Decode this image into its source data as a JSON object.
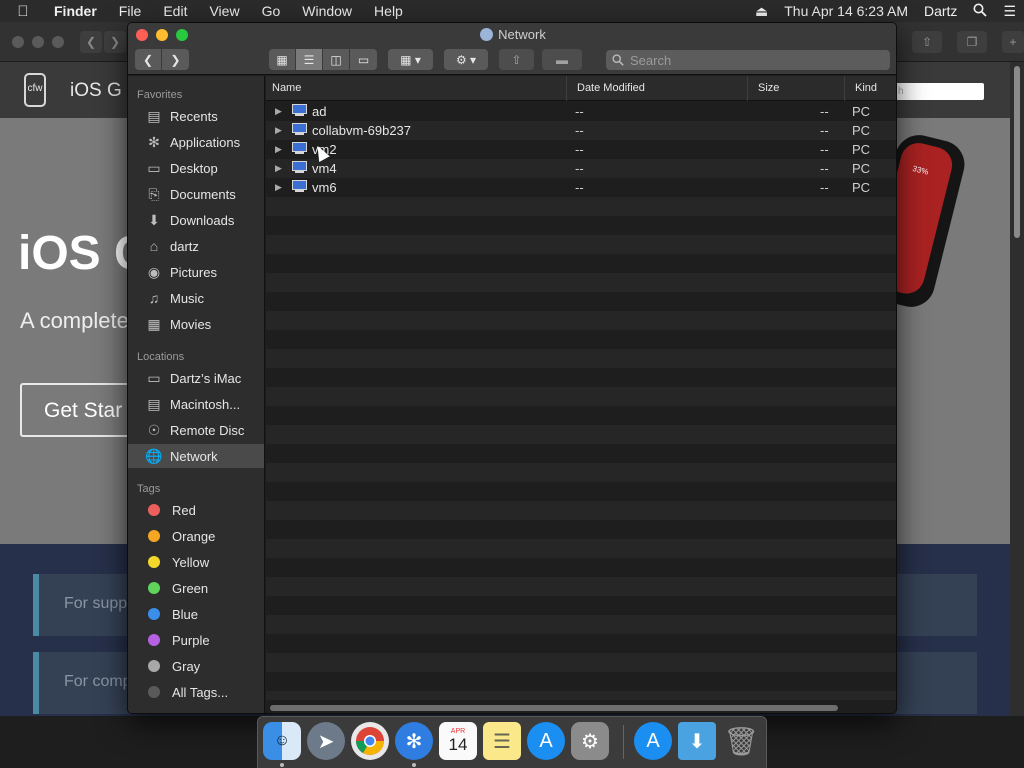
{
  "menubar": {
    "app_name": "Finder",
    "items": [
      "File",
      "Edit",
      "View",
      "Go",
      "Window",
      "Help"
    ],
    "datetime": "Thu Apr 14  6:23 AM",
    "user": "Dartz"
  },
  "browser_bg": {
    "site_logo": "cfw",
    "site_title": "iOS G",
    "search_placeholder": "h",
    "hero_title": "iOS C",
    "hero_subtitle": "A complete",
    "hero_button": "Get Star",
    "phone_text": "33%",
    "notes": [
      "For supp",
      "For comp"
    ]
  },
  "window": {
    "title": "Network",
    "search_placeholder": "Search"
  },
  "sidebar": {
    "favorites_header": "Favorites",
    "favorites": [
      {
        "label": "Recents",
        "icon": "recents-icon"
      },
      {
        "label": "Applications",
        "icon": "applications-icon"
      },
      {
        "label": "Desktop",
        "icon": "desktop-icon"
      },
      {
        "label": "Documents",
        "icon": "documents-icon"
      },
      {
        "label": "Downloads",
        "icon": "downloads-icon"
      },
      {
        "label": "dartz",
        "icon": "home-icon"
      },
      {
        "label": "Pictures",
        "icon": "pictures-icon"
      },
      {
        "label": "Music",
        "icon": "music-icon"
      },
      {
        "label": "Movies",
        "icon": "movies-icon"
      }
    ],
    "locations_header": "Locations",
    "locations": [
      {
        "label": "Dartz’s iMac",
        "icon": "imac-icon"
      },
      {
        "label": "Macintosh...",
        "icon": "disk-icon"
      },
      {
        "label": "Remote Disc",
        "icon": "remote-disc-icon"
      },
      {
        "label": "Network",
        "icon": "network-icon",
        "selected": true
      }
    ],
    "tags_header": "Tags",
    "tags": [
      {
        "label": "Red",
        "color": "#ec5f5d"
      },
      {
        "label": "Orange",
        "color": "#f5a623"
      },
      {
        "label": "Yellow",
        "color": "#f3d82b"
      },
      {
        "label": "Green",
        "color": "#5fd35a"
      },
      {
        "label": "Blue",
        "color": "#3b8eea"
      },
      {
        "label": "Purple",
        "color": "#b462e0"
      },
      {
        "label": "Gray",
        "color": "#a8a8a8"
      },
      {
        "label": "All Tags...",
        "color": "#5a5a5a"
      }
    ]
  },
  "columns": {
    "name": "Name",
    "date": "Date Modified",
    "size": "Size",
    "kind": "Kind"
  },
  "rows": [
    {
      "name": "ad",
      "date": "--",
      "size": "--",
      "kind": "PC"
    },
    {
      "name": "collabvm-69b237",
      "date": "--",
      "size": "--",
      "kind": "PC"
    },
    {
      "name": "vm2",
      "date": "--",
      "size": "--",
      "kind": "PC"
    },
    {
      "name": "vm4",
      "date": "--",
      "size": "--",
      "kind": "PC"
    },
    {
      "name": "vm6",
      "date": "--",
      "size": "--",
      "kind": "PC"
    }
  ],
  "dock": {
    "calendar_day": "14",
    "calendar_month": "APR"
  }
}
